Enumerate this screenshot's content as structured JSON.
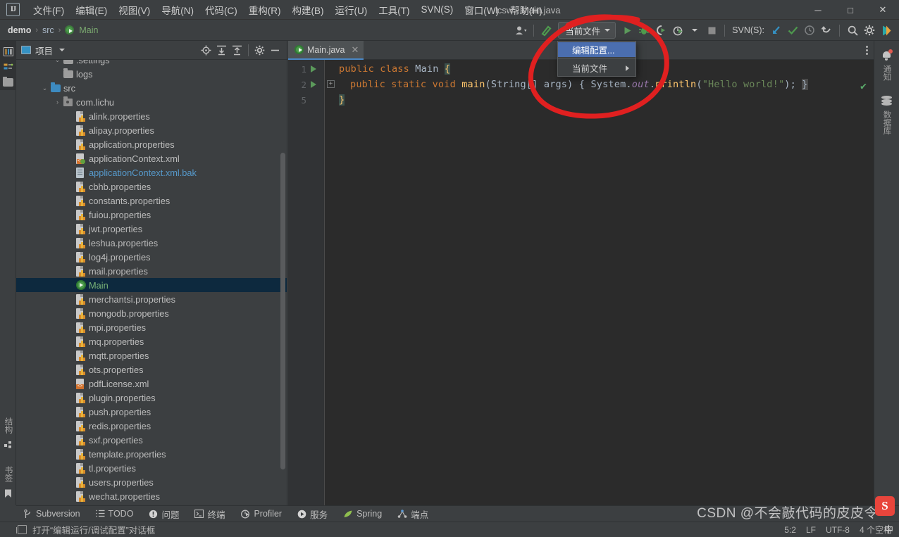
{
  "window": {
    "title": "lcsw - Main.java",
    "minimize": "─",
    "maximize": "□",
    "close": "✕"
  },
  "menubar": {
    "logo": "IJ",
    "items": [
      {
        "label": "文件(F)"
      },
      {
        "label": "编辑(E)"
      },
      {
        "label": "视图(V)"
      },
      {
        "label": "导航(N)"
      },
      {
        "label": "代码(C)"
      },
      {
        "label": "重构(R)"
      },
      {
        "label": "构建(B)"
      },
      {
        "label": "运行(U)"
      },
      {
        "label": "工具(T)"
      },
      {
        "label": "SVN(S)"
      },
      {
        "label": "窗口(W)"
      },
      {
        "label": "帮助(H)"
      }
    ]
  },
  "breadcrumb": {
    "root": "demo",
    "sep": "›",
    "folder": "src",
    "file": "Main"
  },
  "toolbar": {
    "run_config_label": "当前文件",
    "svn_label": "SVN(S):",
    "icons": [
      "user-avatar-icon",
      "build-hammer-icon",
      "run-icon",
      "debug-icon",
      "run-coverage-icon",
      "profile-icon",
      "stop-icon",
      "svn-update-icon",
      "svn-commit-icon",
      "svn-history-icon",
      "svn-rollback-icon",
      "search-everywhere-icon",
      "settings-gear-icon",
      "ide-features-icon"
    ]
  },
  "dropdown": {
    "items": [
      {
        "label": "编辑配置...",
        "selected": true,
        "submenu": false
      },
      {
        "label": "当前文件",
        "selected": false,
        "submenu": true
      }
    ]
  },
  "left_strip": {
    "top_icons": [
      "project-view-icon",
      "commit-icon",
      "structure-folder-icon"
    ],
    "bottom": [
      {
        "label": "结构",
        "icon": "structure-icon"
      },
      {
        "label": "书签",
        "icon": "bookmark-icon"
      }
    ]
  },
  "project_panel": {
    "title": "项目",
    "header_icons": [
      "locate-target-icon",
      "expand-all-icon",
      "collapse-all-icon",
      "settings-gear-icon",
      "hide-icon"
    ],
    "tree": [
      {
        "label": ".settings",
        "icon": "folder-gray",
        "indent": 2,
        "twist": "⌄",
        "cut": true
      },
      {
        "label": "logs",
        "icon": "folder-gray",
        "indent": 2,
        "twist": ""
      },
      {
        "label": "src",
        "icon": "folder-blue",
        "indent": 1,
        "twist": "⌄"
      },
      {
        "label": "com.lichu",
        "icon": "package",
        "indent": 2,
        "twist": "›"
      },
      {
        "label": "alink.properties",
        "icon": "properties",
        "indent": 3,
        "twist": ""
      },
      {
        "label": "alipay.properties",
        "icon": "properties",
        "indent": 3,
        "twist": ""
      },
      {
        "label": "application.properties",
        "icon": "properties",
        "indent": 3,
        "twist": ""
      },
      {
        "label": "applicationContext.xml",
        "icon": "xml",
        "indent": 3,
        "twist": ""
      },
      {
        "label": "applicationContext.xml.bak",
        "icon": "bak",
        "indent": 3,
        "twist": "",
        "color": "blue"
      },
      {
        "label": "cbhb.properties",
        "icon": "properties",
        "indent": 3,
        "twist": ""
      },
      {
        "label": "constants.properties",
        "icon": "properties",
        "indent": 3,
        "twist": ""
      },
      {
        "label": "fuiou.properties",
        "icon": "properties",
        "indent": 3,
        "twist": ""
      },
      {
        "label": "jwt.properties",
        "icon": "properties",
        "indent": 3,
        "twist": ""
      },
      {
        "label": "leshua.properties",
        "icon": "properties",
        "indent": 3,
        "twist": ""
      },
      {
        "label": "log4j.properties",
        "icon": "properties",
        "indent": 3,
        "twist": ""
      },
      {
        "label": "mail.properties",
        "icon": "properties",
        "indent": 3,
        "twist": ""
      },
      {
        "label": "Main",
        "icon": "class",
        "indent": 3,
        "twist": "",
        "selected": true,
        "color": "green"
      },
      {
        "label": "merchantsi.properties",
        "icon": "properties",
        "indent": 3,
        "twist": ""
      },
      {
        "label": "mongodb.properties",
        "icon": "properties",
        "indent": 3,
        "twist": ""
      },
      {
        "label": "mpi.properties",
        "icon": "properties",
        "indent": 3,
        "twist": ""
      },
      {
        "label": "mq.properties",
        "icon": "properties",
        "indent": 3,
        "twist": ""
      },
      {
        "label": "mqtt.properties",
        "icon": "properties",
        "indent": 3,
        "twist": ""
      },
      {
        "label": "ots.properties",
        "icon": "properties",
        "indent": 3,
        "twist": ""
      },
      {
        "label": "pdfLicense.xml",
        "icon": "xml-orange",
        "indent": 3,
        "twist": ""
      },
      {
        "label": "plugin.properties",
        "icon": "properties",
        "indent": 3,
        "twist": ""
      },
      {
        "label": "push.properties",
        "icon": "properties",
        "indent": 3,
        "twist": ""
      },
      {
        "label": "redis.properties",
        "icon": "properties",
        "indent": 3,
        "twist": ""
      },
      {
        "label": "sxf.properties",
        "icon": "properties",
        "indent": 3,
        "twist": ""
      },
      {
        "label": "template.properties",
        "icon": "properties",
        "indent": 3,
        "twist": ""
      },
      {
        "label": "tl.properties",
        "icon": "properties",
        "indent": 3,
        "twist": ""
      },
      {
        "label": "users.properties",
        "icon": "properties",
        "indent": 3,
        "twist": ""
      },
      {
        "label": "wechat.properties",
        "icon": "properties",
        "indent": 3,
        "twist": ""
      }
    ]
  },
  "editor": {
    "tab": {
      "label": "Main.java",
      "close": "✕"
    },
    "lines": [
      {
        "num": "1",
        "runmark": true,
        "fold": false
      },
      {
        "num": "2",
        "runmark": true,
        "fold": true
      },
      {
        "num": "5",
        "runmark": false,
        "fold": false
      }
    ],
    "code": {
      "line1": {
        "kw": "public class",
        "name": "Main",
        "brace": "{"
      },
      "line2": {
        "kw": "public static void",
        "name": "main",
        "params": "(String[] args)",
        "brace": "{",
        "body": "System.out.println(\"Hello world!\"); }"
      },
      "line3": {
        "brace": "}"
      }
    },
    "inspection_status": "✔"
  },
  "right_strip": [
    {
      "label": "通知",
      "icon": "notifications-bell-icon"
    },
    {
      "label": "数据库",
      "icon": "database-icon"
    }
  ],
  "tool_windows": [
    {
      "label": "Subversion",
      "icon": "svn-branch-icon"
    },
    {
      "label": "TODO",
      "icon": "todo-list-icon"
    },
    {
      "label": "问题",
      "icon": "problems-icon"
    },
    {
      "label": "终端",
      "icon": "terminal-icon"
    },
    {
      "label": "Profiler",
      "icon": "profiler-icon"
    },
    {
      "label": "服务",
      "icon": "services-icon"
    },
    {
      "label": "Spring",
      "icon": "spring-leaf-icon"
    },
    {
      "label": "端点",
      "icon": "endpoints-icon"
    }
  ],
  "statusbar": {
    "message": "打开“编辑运行/调试配置”对话框",
    "position": "5:2",
    "line_sep": "LF",
    "encoding": "UTF-8",
    "indent": "4 个空格"
  },
  "watermark": {
    "text": "CSDN @不会敲代码的皮皮令",
    "ime_badge": "S",
    "ime_lang": "中"
  },
  "annotation": {
    "color": "#e02020",
    "shape": "hand-drawn-ellipse-circle"
  }
}
